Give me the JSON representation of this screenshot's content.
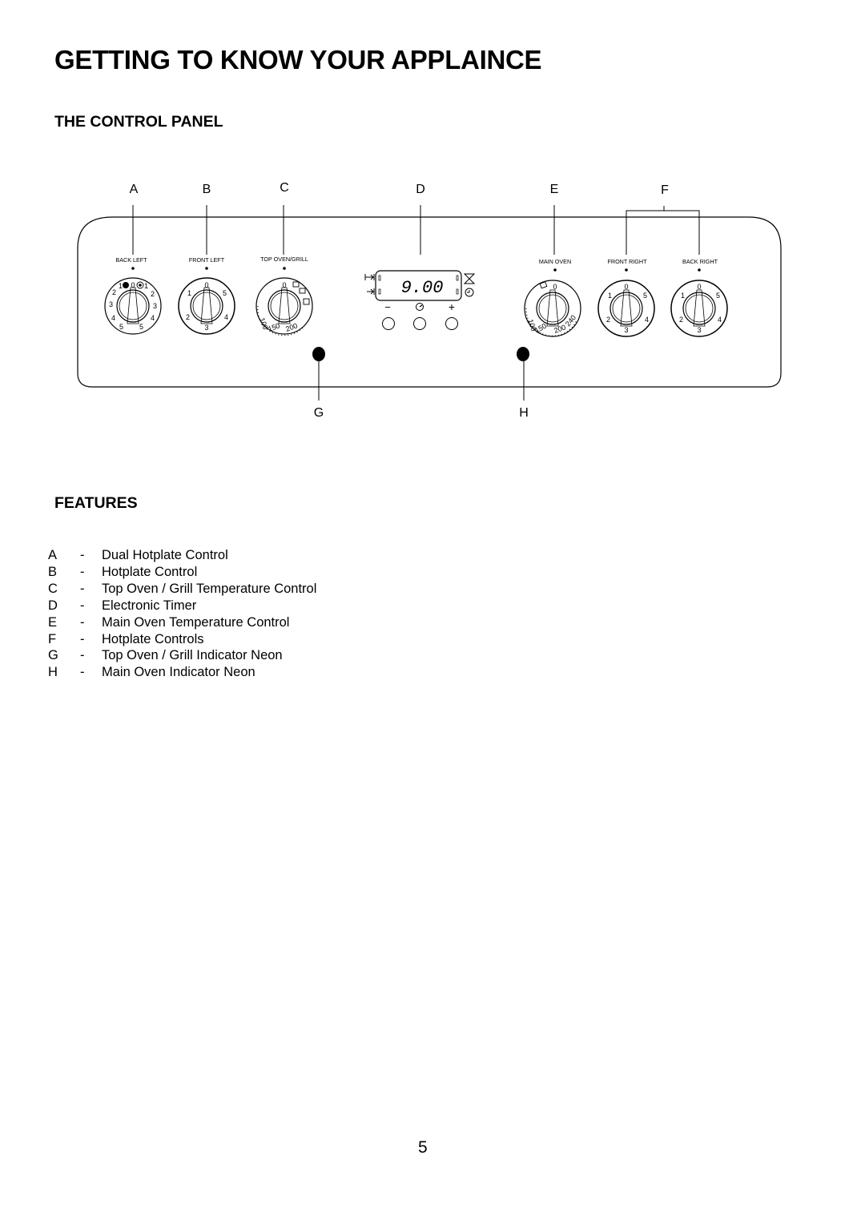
{
  "page": {
    "title": "GETTING TO KNOW YOUR APPLAINCE",
    "page_number": "5"
  },
  "control_panel": {
    "title": "THE CONTROL PANEL",
    "callouts": [
      "A",
      "B",
      "C",
      "D",
      "E",
      "F",
      "G",
      "H"
    ],
    "knobs": [
      {
        "id": "A",
        "label": "BACK LEFT",
        "type": "dual-hotplate",
        "numbers_left": [
          "1",
          "2",
          "3",
          "4",
          "5"
        ],
        "numbers_right": [
          "1",
          "2",
          "3",
          "4",
          "5"
        ],
        "zero": "0"
      },
      {
        "id": "B",
        "label": "FRONT LEFT",
        "type": "hotplate",
        "numbers": [
          "0",
          "1",
          "2",
          "3",
          "4",
          "5"
        ]
      },
      {
        "id": "C",
        "label": "TOP OVEN/GRILL",
        "type": "oven",
        "zero": "0",
        "temps": [
          "100",
          "150",
          "200"
        ]
      },
      {
        "id": "E",
        "label": "MAIN OVEN",
        "type": "oven",
        "zero": "0",
        "temps": [
          "100",
          "150",
          "200",
          "240"
        ]
      },
      {
        "id": "F1",
        "label": "FRONT RIGHT",
        "type": "hotplate",
        "numbers": [
          "0",
          "1",
          "2",
          "3",
          "4",
          "5"
        ]
      },
      {
        "id": "F2",
        "label": "BACK RIGHT",
        "type": "hotplate",
        "numbers": [
          "0",
          "1",
          "2",
          "3",
          "4",
          "5"
        ]
      }
    ],
    "timer": {
      "display": "9.00",
      "buttons": [
        "minus",
        "clock",
        "plus"
      ],
      "minus_symbol": "−",
      "plus_symbol": "+"
    },
    "neons": [
      "G",
      "H"
    ]
  },
  "features": {
    "title": "FEATURES",
    "items": [
      {
        "letter": "A",
        "desc": "Dual Hotplate Control"
      },
      {
        "letter": "B",
        "desc": "Hotplate Control"
      },
      {
        "letter": "C",
        "desc": "Top Oven / Grill Temperature Control"
      },
      {
        "letter": "D",
        "desc": "Electronic Timer"
      },
      {
        "letter": "E",
        "desc": "Main Oven Temperature Control"
      },
      {
        "letter": "F",
        "desc": "Hotplate Controls"
      },
      {
        "letter": "G",
        "desc": "Top Oven / Grill Indicator Neon"
      },
      {
        "letter": "H",
        "desc": "Main Oven Indicator Neon"
      }
    ]
  }
}
